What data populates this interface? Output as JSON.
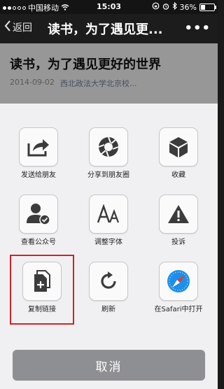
{
  "status_bar": {
    "carrier": "中国移动",
    "time": "15:03",
    "battery": "36%",
    "battery_level": 0.36
  },
  "nav": {
    "back_label": "返回",
    "title": "读书，为了遇见更...",
    "more": "•••"
  },
  "article": {
    "title": "读书，为了遇见更好的世界",
    "date": "2014-09-02",
    "source": "西北政法大学北京校..."
  },
  "actions": [
    {
      "label": "发送给朋友",
      "icon": "share-arrow-icon"
    },
    {
      "label": "分享到朋友圈",
      "icon": "aperture-icon"
    },
    {
      "label": "收藏",
      "icon": "cube-icon"
    },
    {
      "label": "查看公众号",
      "icon": "person-check-icon"
    },
    {
      "label": "调整字体",
      "icon": "font-size-icon"
    },
    {
      "label": "投诉",
      "icon": "warning-icon"
    },
    {
      "label": "复制链接",
      "icon": "copy-document-icon"
    },
    {
      "label": "刷新",
      "icon": "refresh-icon"
    },
    {
      "label": "在Safari中打开",
      "icon": "safari-compass-icon"
    }
  ],
  "cancel_label": "取消",
  "colors": {
    "highlight": "#d52027",
    "safari_blue": "#1e8ee8",
    "cancel_bg": "#8e8f92"
  }
}
